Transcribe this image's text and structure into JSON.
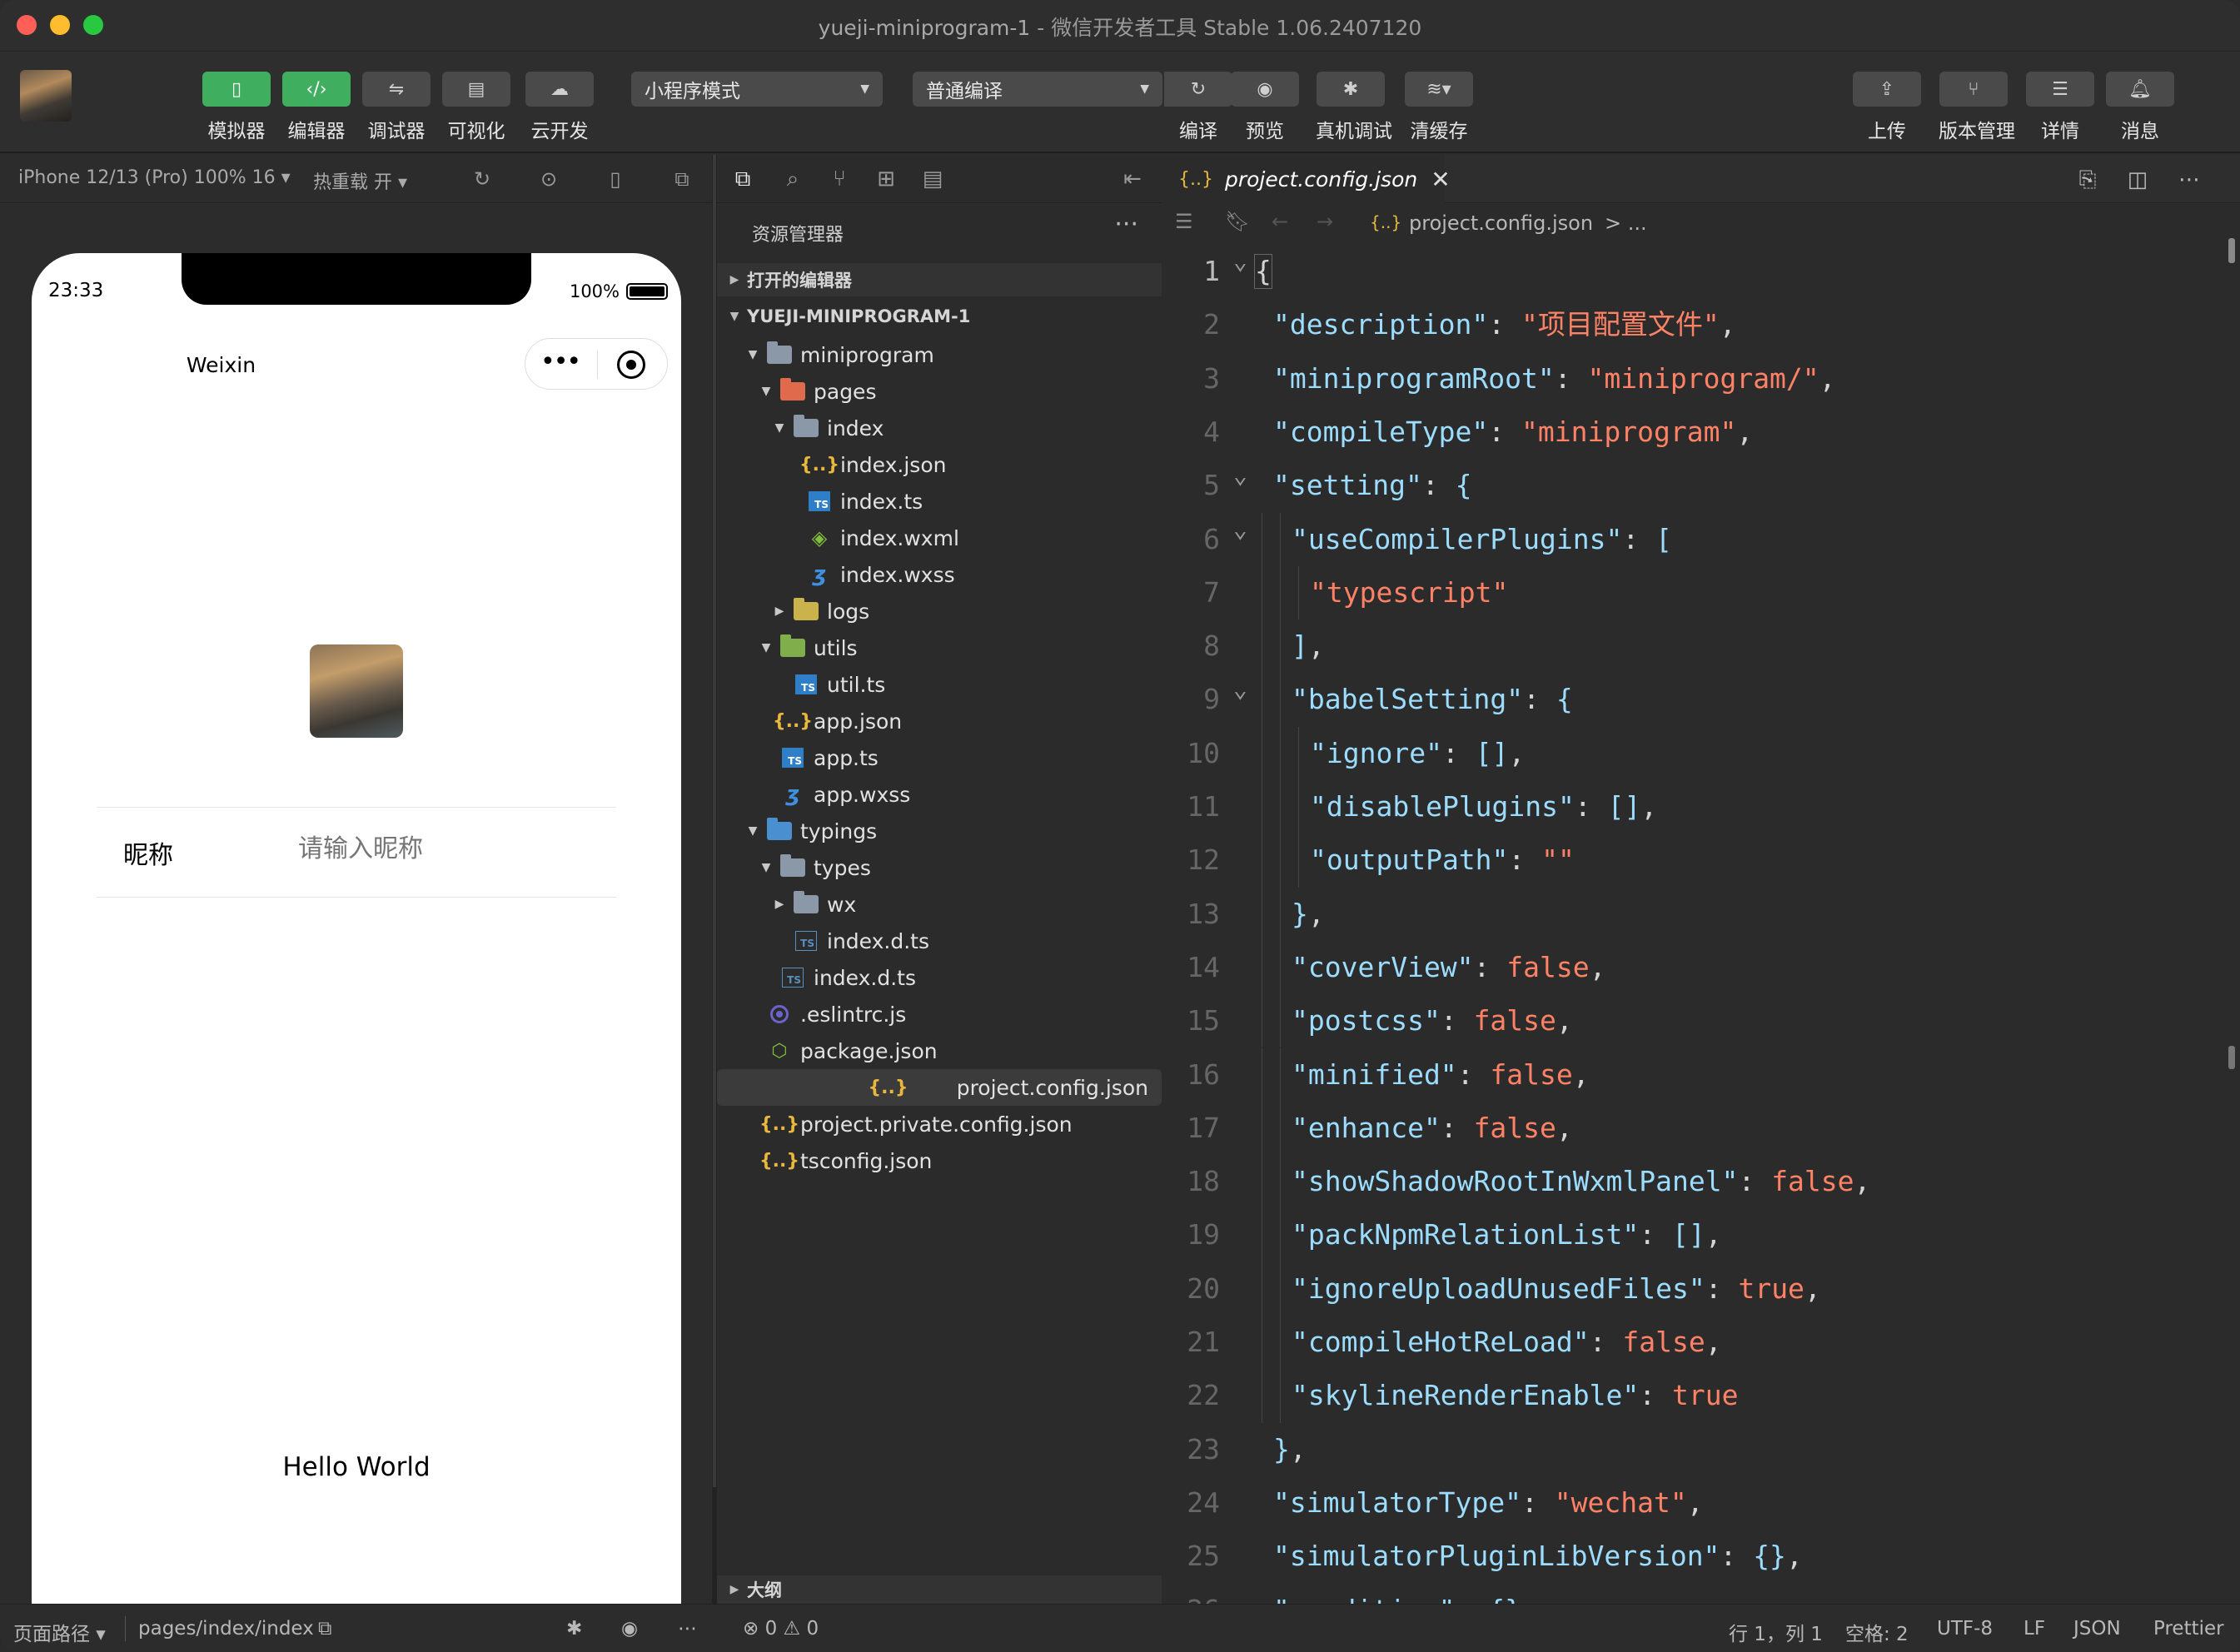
{
  "window": {
    "title": "yueji-miniprogram-1",
    "subtitle": "- 微信开发者工具 Stable 1.06.2407120"
  },
  "toolbar": {
    "left_buttons": [
      {
        "label": "模拟器",
        "icon": "phone-icon",
        "active": true
      },
      {
        "label": "编辑器",
        "icon": "code-icon",
        "active": true
      },
      {
        "label": "调试器",
        "icon": "debug-icon",
        "active": false
      },
      {
        "label": "可视化",
        "icon": "layout-icon",
        "active": false
      },
      {
        "label": "云开发",
        "icon": "cloud-icon",
        "active": false
      }
    ],
    "mode_select": "小程序模式",
    "compile_select": "普通编译",
    "mid_buttons": [
      {
        "label": "编译",
        "icon": "refresh-icon"
      },
      {
        "label": "预览",
        "icon": "eye-icon"
      },
      {
        "label": "真机调试",
        "icon": "bug-icon"
      },
      {
        "label": "清缓存",
        "icon": "layers-icon"
      }
    ],
    "right_buttons": [
      {
        "label": "上传",
        "icon": "upload-icon"
      },
      {
        "label": "版本管理",
        "icon": "branch-icon"
      },
      {
        "label": "详情",
        "icon": "menu-icon"
      },
      {
        "label": "消息",
        "icon": "bell-icon"
      }
    ]
  },
  "simulator": {
    "device": "iPhone 12/13 (Pro) 100% 16 ▾",
    "hot_reload": "热重载 开 ▾",
    "phone": {
      "time": "23:33",
      "battery": "100%",
      "nav_title": "Weixin",
      "nickname_label": "昵称",
      "nickname_placeholder": "请输入昵称",
      "hello": "Hello World"
    }
  },
  "explorer": {
    "header": "资源管理器",
    "more": "···",
    "open_editors": "打开的编辑器",
    "project": "YUEJI-MINIPROGRAM-1",
    "outline": "大纲",
    "tree": [
      {
        "name": "miniprogram",
        "type": "folder",
        "color": "grey",
        "depth": 1,
        "open": true
      },
      {
        "name": "pages",
        "type": "folder",
        "color": "red",
        "depth": 2,
        "open": true
      },
      {
        "name": "index",
        "type": "folder",
        "color": "grey",
        "depth": 3,
        "open": true
      },
      {
        "name": "index.json",
        "type": "json",
        "depth": 4
      },
      {
        "name": "index.ts",
        "type": "ts",
        "depth": 4
      },
      {
        "name": "index.wxml",
        "type": "wxml",
        "depth": 4
      },
      {
        "name": "index.wxss",
        "type": "wxss",
        "depth": 4
      },
      {
        "name": "logs",
        "type": "folder",
        "color": "yellow",
        "depth": 3,
        "open": false
      },
      {
        "name": "utils",
        "type": "folder",
        "color": "green",
        "depth": 2,
        "open": true
      },
      {
        "name": "util.ts",
        "type": "ts",
        "depth": 3
      },
      {
        "name": "app.json",
        "type": "json",
        "depth": 2
      },
      {
        "name": "app.ts",
        "type": "ts",
        "depth": 2
      },
      {
        "name": "app.wxss",
        "type": "wxss",
        "depth": 2
      },
      {
        "name": "typings",
        "type": "folder",
        "color": "blue",
        "depth": 1,
        "open": true
      },
      {
        "name": "types",
        "type": "folder",
        "color": "grey",
        "depth": 2,
        "open": true
      },
      {
        "name": "wx",
        "type": "folder",
        "color": "grey",
        "depth": 3,
        "open": false
      },
      {
        "name": "index.d.ts",
        "type": "ts-outline",
        "depth": 3
      },
      {
        "name": "index.d.ts",
        "type": "ts-outline",
        "depth": 2
      },
      {
        "name": ".eslintrc.js",
        "type": "eslint",
        "depth": 1
      },
      {
        "name": "package.json",
        "type": "pkg",
        "depth": 1
      },
      {
        "name": "project.config.json",
        "type": "json",
        "depth": 1,
        "selected": true
      },
      {
        "name": "project.private.config.json",
        "type": "json",
        "depth": 1
      },
      {
        "name": "tsconfig.json",
        "type": "json",
        "depth": 1
      }
    ]
  },
  "editor": {
    "tab": "project.config.json",
    "breadcrumb": "project.config.json",
    "breadcrumb_more": "> ...",
    "lines": [
      [
        [
          "p",
          "{"
        ]
      ],
      [
        [
          "k",
          "\"description\""
        ],
        [
          "p",
          ": "
        ],
        [
          "s",
          "\"项目配置文件\""
        ],
        [
          "p",
          ","
        ]
      ],
      [
        [
          "k",
          "\"miniprogramRoot\""
        ],
        [
          "p",
          ": "
        ],
        [
          "s",
          "\"miniprogram/\""
        ],
        [
          "p",
          ","
        ]
      ],
      [
        [
          "k",
          "\"compileType\""
        ],
        [
          "p",
          ": "
        ],
        [
          "s",
          "\"miniprogram\""
        ],
        [
          "p",
          ","
        ]
      ],
      [
        [
          "k",
          "\"setting\""
        ],
        [
          "p",
          ": "
        ],
        [
          "br",
          "{"
        ]
      ],
      [
        [
          "k",
          "\"useCompilerPlugins\""
        ],
        [
          "p",
          ": "
        ],
        [
          "br",
          "["
        ]
      ],
      [
        [
          "s",
          "\"typescript\""
        ]
      ],
      [
        [
          "br",
          "]"
        ],
        [
          "p",
          ","
        ]
      ],
      [
        [
          "k",
          "\"babelSetting\""
        ],
        [
          "p",
          ": "
        ],
        [
          "br",
          "{"
        ]
      ],
      [
        [
          "k",
          "\"ignore\""
        ],
        [
          "p",
          ": "
        ],
        [
          "br",
          "[]"
        ],
        [
          "p",
          ","
        ]
      ],
      [
        [
          "k",
          "\"disablePlugins\""
        ],
        [
          "p",
          ": "
        ],
        [
          "br",
          "[]"
        ],
        [
          "p",
          ","
        ]
      ],
      [
        [
          "k",
          "\"outputPath\""
        ],
        [
          "p",
          ": "
        ],
        [
          "s",
          "\"\""
        ]
      ],
      [
        [
          "br",
          "}"
        ],
        [
          "p",
          ","
        ]
      ],
      [
        [
          "k",
          "\"coverView\""
        ],
        [
          "p",
          ": "
        ],
        [
          "b",
          "false"
        ],
        [
          "p",
          ","
        ]
      ],
      [
        [
          "k",
          "\"postcss\""
        ],
        [
          "p",
          ": "
        ],
        [
          "b",
          "false"
        ],
        [
          "p",
          ","
        ]
      ],
      [
        [
          "k",
          "\"minified\""
        ],
        [
          "p",
          ": "
        ],
        [
          "b",
          "false"
        ],
        [
          "p",
          ","
        ]
      ],
      [
        [
          "k",
          "\"enhance\""
        ],
        [
          "p",
          ": "
        ],
        [
          "b",
          "false"
        ],
        [
          "p",
          ","
        ]
      ],
      [
        [
          "k",
          "\"showShadowRootInWxmlPanel\""
        ],
        [
          "p",
          ": "
        ],
        [
          "b",
          "false"
        ],
        [
          "p",
          ","
        ]
      ],
      [
        [
          "k",
          "\"packNpmRelationList\""
        ],
        [
          "p",
          ": "
        ],
        [
          "br",
          "[]"
        ],
        [
          "p",
          ","
        ]
      ],
      [
        [
          "k",
          "\"ignoreUploadUnusedFiles\""
        ],
        [
          "p",
          ": "
        ],
        [
          "b",
          "true"
        ],
        [
          "p",
          ","
        ]
      ],
      [
        [
          "k",
          "\"compileHotReLoad\""
        ],
        [
          "p",
          ": "
        ],
        [
          "b",
          "false"
        ],
        [
          "p",
          ","
        ]
      ],
      [
        [
          "k",
          "\"skylineRenderEnable\""
        ],
        [
          "p",
          ": "
        ],
        [
          "b",
          "true"
        ]
      ],
      [
        [
          "br",
          "}"
        ],
        [
          "p",
          ","
        ]
      ],
      [
        [
          "k",
          "\"simulatorType\""
        ],
        [
          "p",
          ": "
        ],
        [
          "s",
          "\"wechat\""
        ],
        [
          "p",
          ","
        ]
      ],
      [
        [
          "k",
          "\"simulatorPluginLibVersion\""
        ],
        [
          "p",
          ": "
        ],
        [
          "br",
          "{}"
        ],
        [
          "p",
          ","
        ]
      ],
      [
        [
          "k",
          "\"condition\""
        ],
        [
          "p",
          ": "
        ],
        [
          "br",
          "{}"
        ],
        [
          "p",
          ","
        ]
      ]
    ],
    "indents": [
      0,
      1,
      1,
      1,
      1,
      2,
      3,
      2,
      2,
      3,
      3,
      3,
      2,
      2,
      2,
      2,
      2,
      2,
      2,
      2,
      2,
      2,
      1,
      1,
      1,
      1
    ],
    "folds": [
      1,
      5,
      6,
      9
    ]
  },
  "statusbar": {
    "page_path_label": "页面路径 ▾",
    "page_path": "pages/index/index",
    "errors": "0",
    "warnings": "0",
    "position": "行 1，列 1",
    "spaces": "空格: 2",
    "encoding": "UTF-8",
    "eol": "LF",
    "language": "JSON",
    "formatter": "Prettier"
  },
  "colors": {
    "accent_green": "#3fae5e",
    "key": "#9cdcfe",
    "string": "#ff8266"
  }
}
